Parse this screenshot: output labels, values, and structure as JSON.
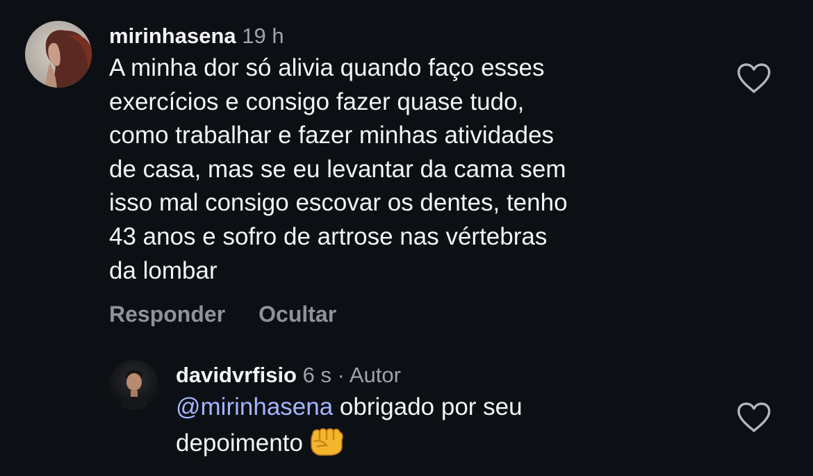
{
  "comments": [
    {
      "username": "mirinhasena",
      "time": "19 h",
      "text": "A minha dor só alivia quando faço esses\nexercícios e consigo fazer quase tudo,\ncomo trabalhar e fazer minhas atividades\nde casa, mas se eu levantar da cama sem\nisso mal consigo escovar os dentes, tenho\n43 anos e sofro de artrose nas vértebras\nda lombar",
      "actions": {
        "reply": "Responder",
        "hide": "Ocultar"
      },
      "like_icon": "heart-outline-icon"
    },
    {
      "username": "davidvrfisio",
      "time": "6 s",
      "separator": "·",
      "badge": "Autor",
      "mention": "@mirinhasena",
      "text_after_mention": " obrigado por seu\ndepoimento",
      "emoji": "oncoming-fist-emoji",
      "like_icon": "heart-outline-icon"
    }
  ],
  "colors": {
    "background": "#0c0f14",
    "primary_text": "#f5f5f5",
    "secondary_text": "#a0a4aa",
    "action_text": "#8e939b",
    "mention": "#a3b6ff"
  }
}
